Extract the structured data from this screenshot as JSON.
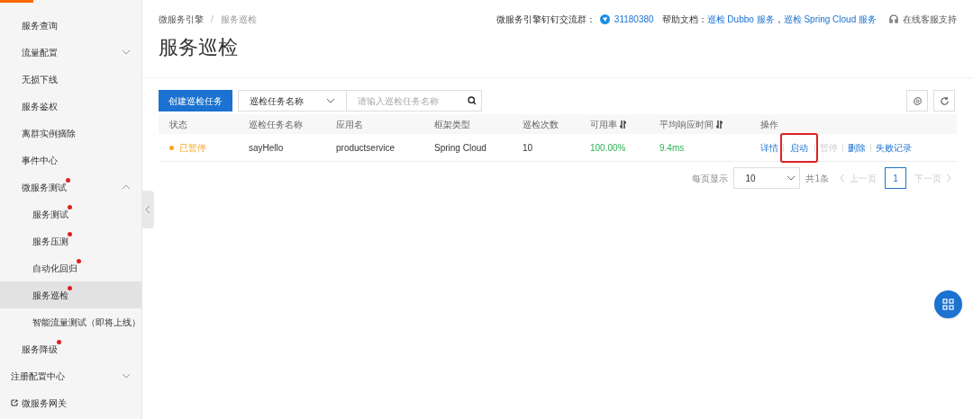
{
  "sidebar": {
    "items": [
      {
        "label": "服务查询",
        "selected": false,
        "badge": false
      },
      {
        "label": "流量配置",
        "selected": false,
        "badge": false,
        "expanded": false
      },
      {
        "label": "无损下线",
        "selected": false,
        "badge": false
      },
      {
        "label": "服务鉴权",
        "selected": false,
        "badge": false
      },
      {
        "label": "离群实例摘除",
        "selected": false,
        "badge": false
      },
      {
        "label": "事件中心",
        "selected": false,
        "badge": false
      },
      {
        "label": "微服务测试",
        "selected": false,
        "badge": true,
        "expanded": true,
        "children": [
          {
            "label": "服务测试",
            "selected": false,
            "badge": true
          },
          {
            "label": "服务压测",
            "selected": false,
            "badge": true
          },
          {
            "label": "自动化回归",
            "selected": false,
            "badge": true
          },
          {
            "label": "服务巡检",
            "selected": true,
            "badge": true
          },
          {
            "label": "智能流量测试（即将上线）",
            "selected": false,
            "badge": false
          }
        ]
      },
      {
        "label": "服务降级",
        "selected": false,
        "badge": true
      }
    ],
    "sections": [
      {
        "kind": "group",
        "label": "注册配置中心",
        "expanded": false
      },
      {
        "kind": "external",
        "label": "微服务网关"
      }
    ]
  },
  "breadcrumb": [
    "微服务引擎",
    "服务巡检"
  ],
  "breadcrumb_separator": "/",
  "header_links": {
    "group_label": "微服务引擎钉钉交流群：",
    "group_number": "31180380",
    "docs_label": "帮助文档：",
    "docs": [
      "巡检 Dubbo 服务",
      "巡检 Spring Cloud 服务"
    ],
    "docs_separator": "，",
    "support": "在线客服支持"
  },
  "title": "服务巡检",
  "toolbar": {
    "create_button": "创建巡检任务",
    "filter": "巡检任务名称",
    "search": {
      "placeholder": "请输入巡检任务名称"
    }
  },
  "table": {
    "columns": [
      {
        "label": "状态",
        "sortable": false
      },
      {
        "label": "巡检任务名称",
        "sortable": false
      },
      {
        "label": "应用名",
        "sortable": false
      },
      {
        "label": "框架类型",
        "sortable": false
      },
      {
        "label": "巡检次数",
        "sortable": false
      },
      {
        "label": "可用率",
        "sortable": true
      },
      {
        "label": "平均响应时间",
        "sortable": true
      },
      {
        "label": "操作",
        "sortable": false
      }
    ],
    "rows": [
      {
        "status": "已暂停",
        "color": "#f5a623",
        "name": "sayHello",
        "app": "productservice",
        "framework": "Spring Cloud",
        "count": "10",
        "availability": "100.00%",
        "latency": "9.4ms",
        "actions": [
          {
            "label": "详情",
            "disabled": false,
            "highlighted": false
          },
          {
            "label": "启动",
            "disabled": false,
            "highlighted": true
          },
          {
            "label": "暂停",
            "disabled": true,
            "highlighted": false
          },
          {
            "label": "删除",
            "disabled": false,
            "highlighted": false
          },
          {
            "label": "失败记录",
            "disabled": false,
            "highlighted": false
          }
        ]
      }
    ]
  },
  "pagination": {
    "page_size_label": "每页显示",
    "page_size": "10",
    "total": "共1条",
    "prev": "上一页",
    "pages": [
      {
        "label": "1",
        "selected": true
      }
    ],
    "next": "下一页"
  }
}
